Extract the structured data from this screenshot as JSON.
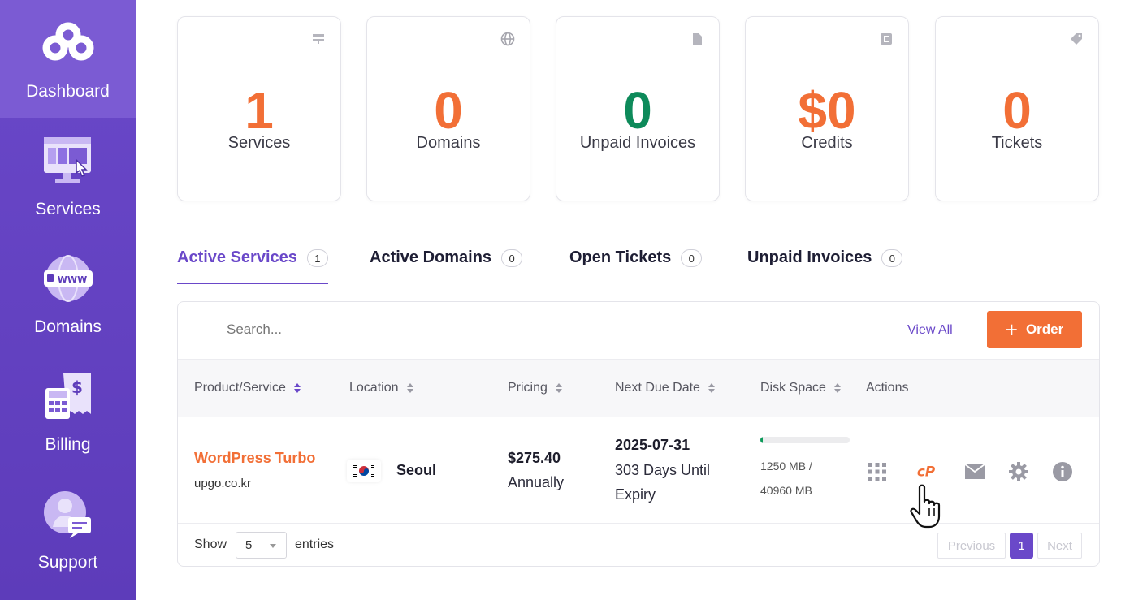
{
  "sidebar": {
    "items": [
      {
        "label": "Dashboard",
        "icon": "logo-icon",
        "active": true
      },
      {
        "label": "Services",
        "icon": "services-icon"
      },
      {
        "label": "Domains",
        "icon": "domains-icon"
      },
      {
        "label": "Billing",
        "icon": "billing-icon"
      },
      {
        "label": "Support",
        "icon": "support-icon"
      }
    ]
  },
  "stats": [
    {
      "value": "1",
      "label": "Services",
      "icon": "server-icon"
    },
    {
      "value": "0",
      "label": "Domains",
      "icon": "globe-icon"
    },
    {
      "value": "0",
      "label": "Unpaid Invoices",
      "icon": "file-icon",
      "color": "#0d8a5a"
    },
    {
      "value": "$0",
      "label": "Credits",
      "icon": "credit-icon"
    },
    {
      "value": "0",
      "label": "Tickets",
      "icon": "tag-icon"
    }
  ],
  "tabs": [
    {
      "label": "Active Services",
      "count": "1",
      "active": true
    },
    {
      "label": "Active Domains",
      "count": "0"
    },
    {
      "label": "Open Tickets",
      "count": "0"
    },
    {
      "label": "Unpaid Invoices",
      "count": "0"
    }
  ],
  "toolbar": {
    "search_placeholder": "Search...",
    "view_all": "View All",
    "order_label": "Order"
  },
  "table": {
    "headers": [
      "Product/Service",
      "Location",
      "Pricing",
      "Next Due Date",
      "Disk Space",
      "Actions"
    ],
    "rows": [
      {
        "product": "WordPress Turbo",
        "domain": "upgo.co.kr",
        "location": "Seoul",
        "price": "$275.40",
        "cycle": "Annually",
        "due_date": "2025-07-31",
        "due_line1": "303 Days Until",
        "due_line2": "Expiry",
        "disk_used": "1250 MB /",
        "disk_total": "40960 MB",
        "disk_fraction": 0.03
      }
    ]
  },
  "footer": {
    "show": "Show",
    "page_size": "5",
    "entries": "entries",
    "previous": "Previous",
    "current_page": "1",
    "next": "Next"
  },
  "colors": {
    "brand": "#6a48c9",
    "accent": "#f26f36",
    "success": "#0d8a5a"
  }
}
